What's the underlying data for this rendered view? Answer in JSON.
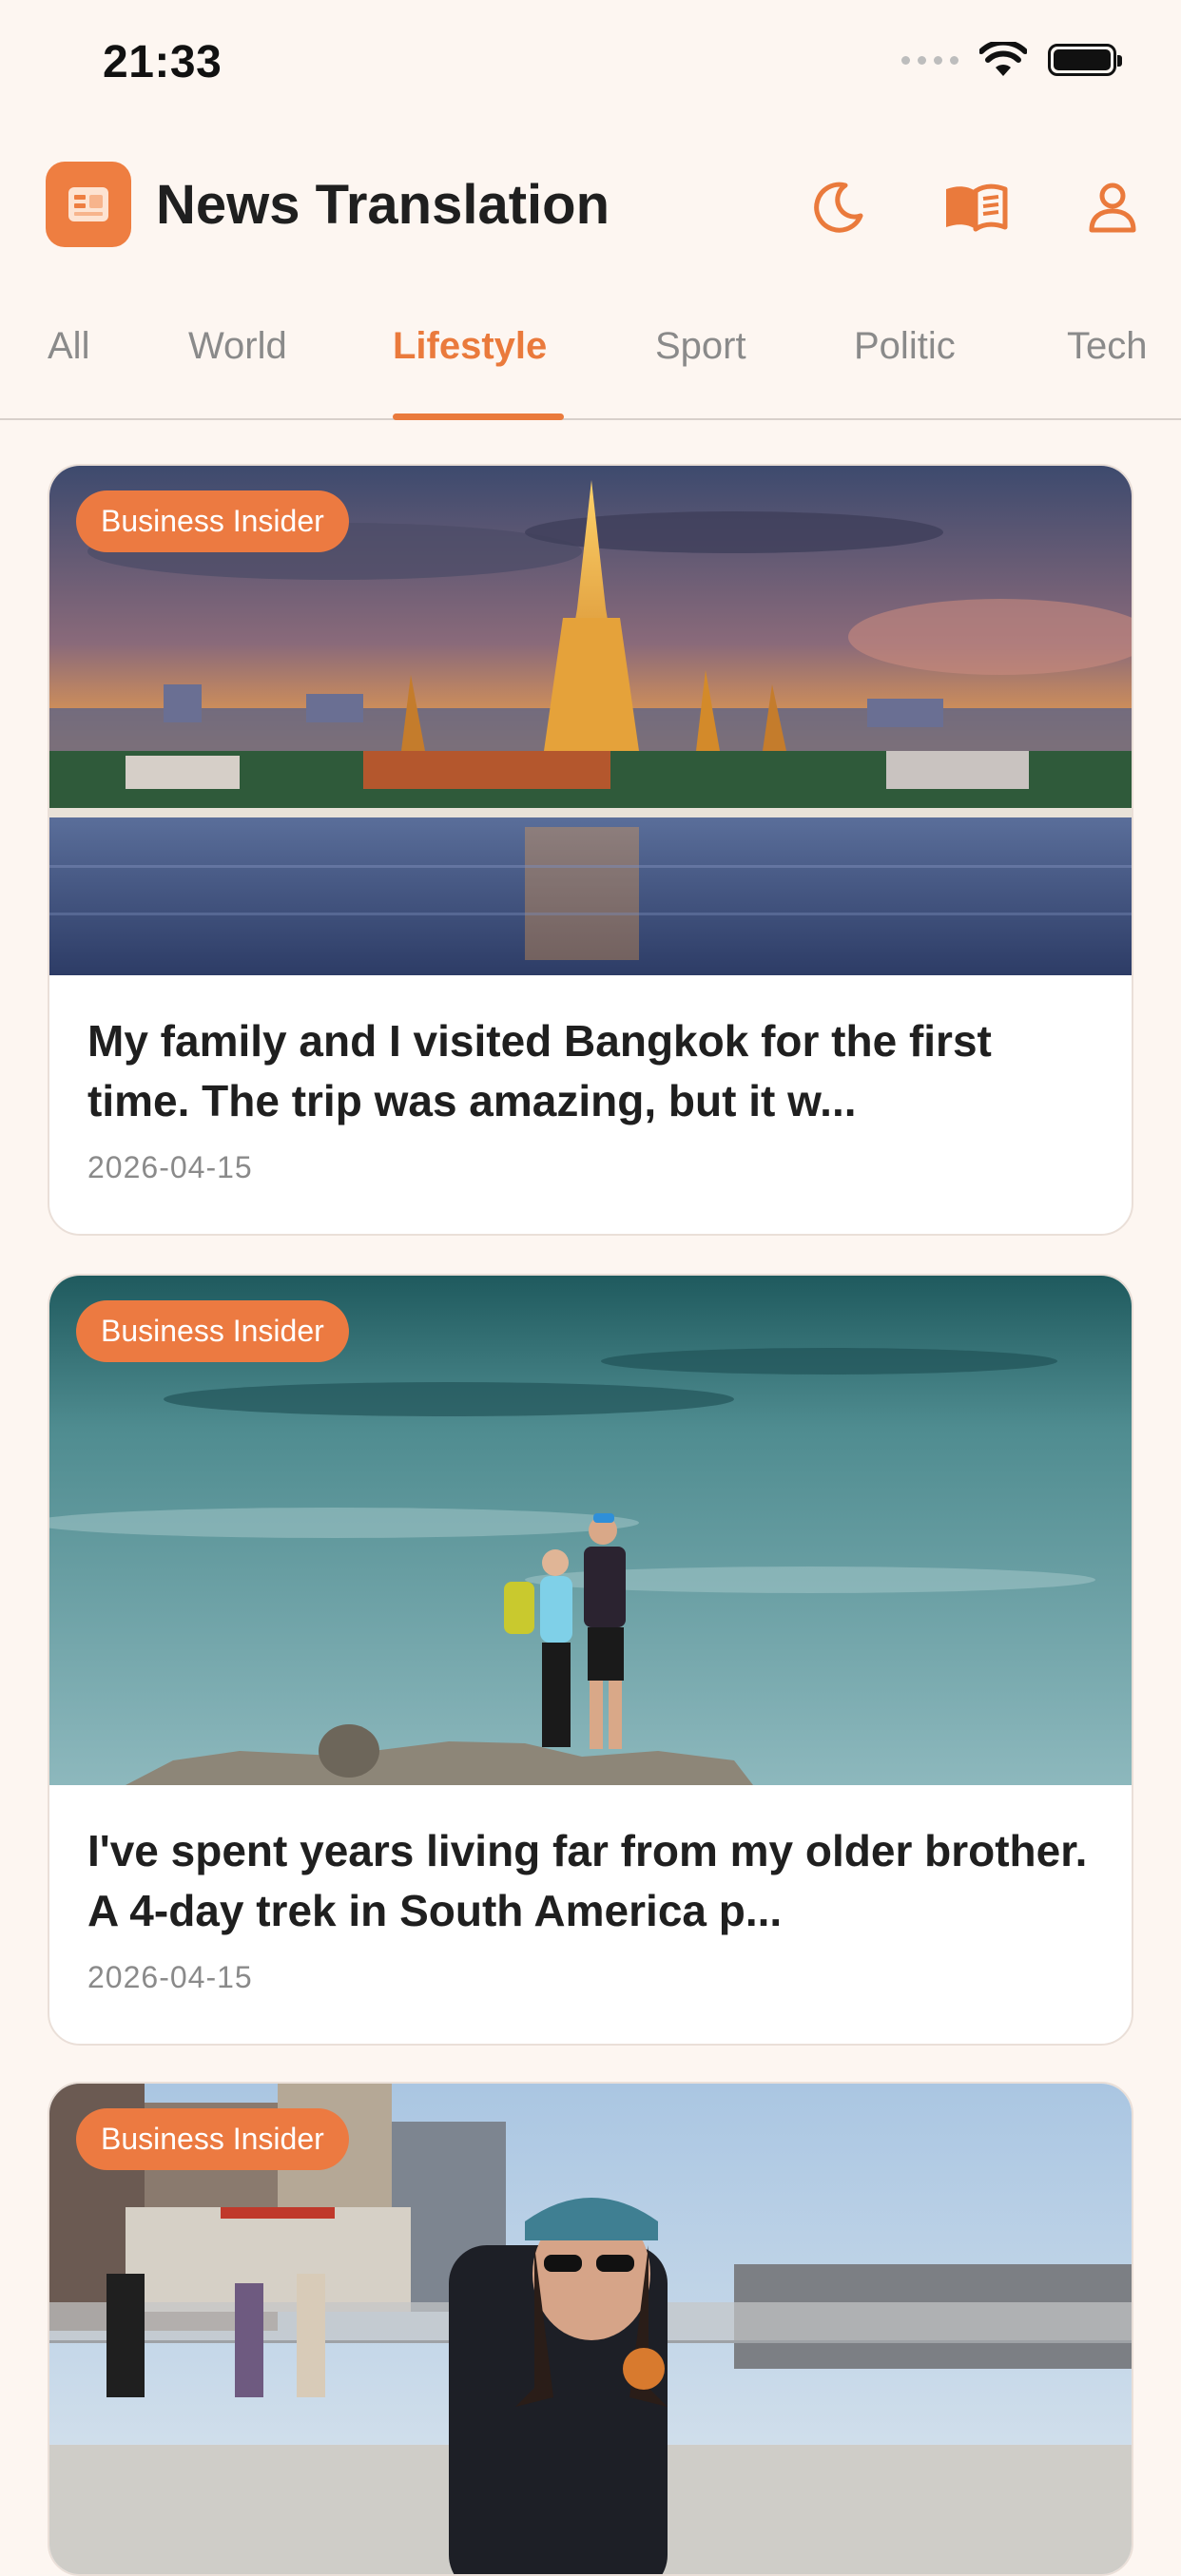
{
  "status_bar": {
    "time": "21:33"
  },
  "header": {
    "title": "News Translation"
  },
  "tabs": [
    {
      "label": "All",
      "active": false
    },
    {
      "label": "World",
      "active": false
    },
    {
      "label": "Lifestyle",
      "active": true
    },
    {
      "label": "Sport",
      "active": false
    },
    {
      "label": "Politic",
      "active": false
    },
    {
      "label": "Tech",
      "active": false
    }
  ],
  "colors": {
    "accent": "#ea7a3c",
    "background": "#fdf6f1",
    "card": "#ffffff"
  },
  "articles": [
    {
      "source": "Business Insider",
      "title": "My family and I visited Bangkok for the first time. The trip was amazing, but it w...",
      "date": "2026-04-15"
    },
    {
      "source": "Business Insider",
      "title": "I've spent years living far from my older brother. A 4-day trek in South America p...",
      "date": "2026-04-15"
    },
    {
      "source": "Business Insider",
      "title": "",
      "date": ""
    }
  ]
}
